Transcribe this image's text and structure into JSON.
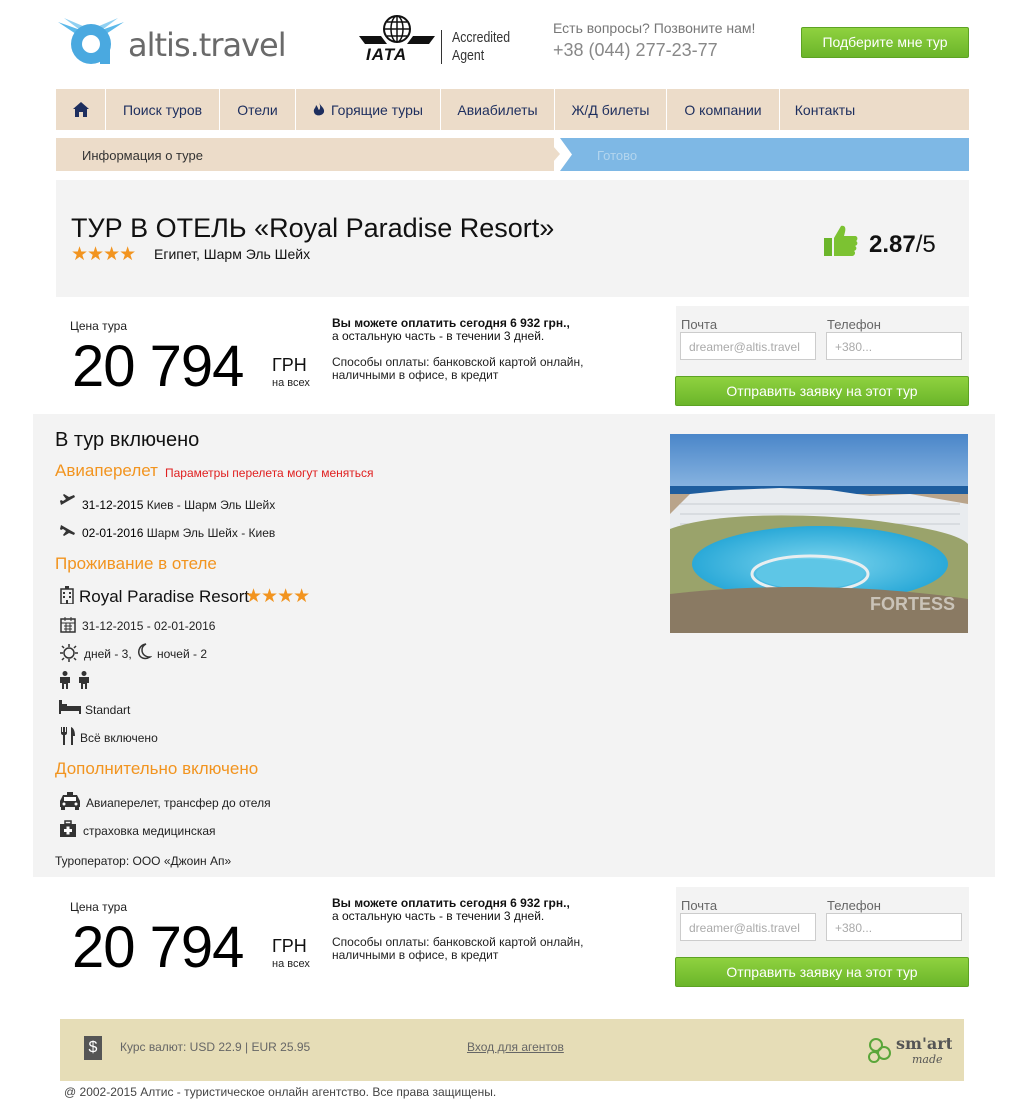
{
  "header": {
    "logo_text": "altis.travel",
    "iata_word": "IATA",
    "accredited_line1": "Accredited",
    "accredited_line2": "Agent",
    "question": "Есть вопросы? Позвоните нам!",
    "phone": "+38 (044) 277-23-77",
    "pick_button": "Подберите мне тур"
  },
  "nav": {
    "items": [
      {
        "label": "Поиск туров"
      },
      {
        "label": "Отели"
      },
      {
        "label": "Горящие туры"
      },
      {
        "label": "Авиабилеты"
      },
      {
        "label": "Ж/Д билеты"
      },
      {
        "label": "О компании"
      },
      {
        "label": "Контакты"
      }
    ]
  },
  "steps": {
    "step1": "Информация о туре",
    "step2": "Готово"
  },
  "tour": {
    "title": "ТУР В ОТЕЛЬ «Royal Paradise Resort»",
    "hotel_stars": 4,
    "stars_text": "★★★★",
    "location": "Египет, Шарм Эль Шейх",
    "rating_value": "2.87",
    "rating_max": "/5"
  },
  "price": {
    "label": "Цена тура",
    "value": "20 794",
    "currency": "ГРН",
    "currency_sub": "на всех",
    "pay_today_bold": "Вы можете оплатить сегодня 6 932 грн.,",
    "pay_today_rest": "а остальную часть - в течении 3 дней.",
    "methods_line1": "Способы оплаты: банковской картой онлайн,",
    "methods_line2": "наличными в офисе, в кредит"
  },
  "form": {
    "email_label": "Почта",
    "email_placeholder": "dreamer@altis.travel",
    "phone_label": "Телефон",
    "phone_placeholder": "+380...",
    "send_button": "Отправить заявку на этот тур"
  },
  "included": {
    "heading": "В тур включено",
    "flight_heading": "Авиаперелет",
    "flight_note": "Параметры перелета могут меняться",
    "flights": [
      {
        "date": "31-12-2015",
        "route": "Киев - Шарм Эль Шейх"
      },
      {
        "date": "02-01-2016",
        "route": "Шарм Эль Шейх - Киев"
      }
    ],
    "stay_heading": "Проживание в отеле",
    "hotel_name": "Royal Paradise Resort",
    "dates": "31-12-2015 - 02-01-2016",
    "days": "дней - 3,",
    "nights": "ночей - 2",
    "room": "Standart",
    "meal": "Всё включено",
    "extra_heading": "Дополнительно включено",
    "transfer": "Авиаперелет, трансфер до отеля",
    "insurance": "страховка медицинская",
    "operator": "Туроператор: ООО «Джоин Ап»",
    "photo_watermark": "FORTESS"
  },
  "footer": {
    "dollar": "$",
    "rates": "Курс валют: USD 22.9 | EUR 25.95",
    "agents_link": "Вход для агентов",
    "smart_top": "sm'art",
    "smart_bottom": "made",
    "copyright": "@ 2002-2015   Алтис - туристическое онлайн агентство. Все права защищены."
  },
  "colors": {
    "accent_orange": "#f2941f",
    "nav_bg": "#ecdcc9",
    "button_green": "#7cc232",
    "step_blue": "#7eb8e5",
    "footer_bg": "#e6ddb7"
  }
}
